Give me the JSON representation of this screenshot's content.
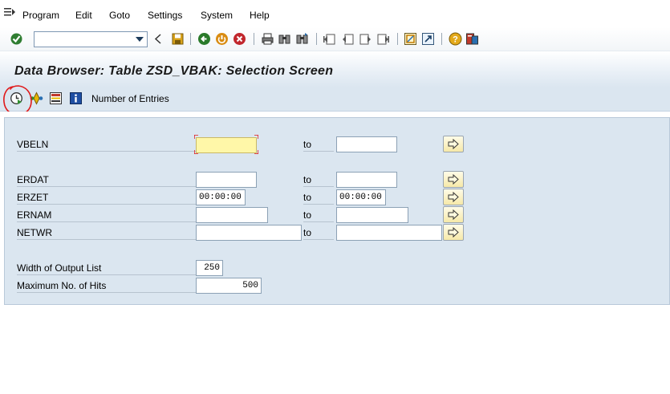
{
  "menubar": {
    "items": [
      "Program",
      "Edit",
      "Goto",
      "Settings",
      "System",
      "Help"
    ]
  },
  "toolbar": {
    "command_field_value": "",
    "icons": [
      "enter-icon",
      "back-icon",
      "exit-icon",
      "cancel-icon",
      "save-icon",
      "print-icon",
      "find-icon",
      "find-next-icon",
      "first-page-icon",
      "previous-page-icon",
      "next-page-icon",
      "last-page-icon",
      "create-session-icon",
      "shortcut-icon",
      "help-icon",
      "layout-icon"
    ]
  },
  "title": "Data Browser: Table ZSD_VBAK: Selection Screen",
  "app_toolbar": {
    "number_of_entries_label": "Number of Entries",
    "icons": [
      "execute-icon",
      "selection-options-icon",
      "field-selection-icon",
      "info-icon"
    ]
  },
  "selection": {
    "rows": [
      {
        "label": "VBELN",
        "to": "to",
        "low": "",
        "high": ""
      },
      {
        "label": "ERDAT",
        "to": "to",
        "low": "",
        "high": ""
      },
      {
        "label": "ERZET",
        "to": "to",
        "low": "00:00:00",
        "high": "00:00:00"
      },
      {
        "label": "ERNAM",
        "to": "to",
        "low": "",
        "high": ""
      },
      {
        "label": "NETWR",
        "to": "to",
        "low": "",
        "high": ""
      }
    ],
    "settings": [
      {
        "label": "Width of Output List",
        "value": "250"
      },
      {
        "label": "Maximum No. of Hits",
        "value": "500"
      }
    ]
  },
  "colors": {
    "panel_bg": "#dbe6f0",
    "focused_field_bg": "#fff7a8",
    "annotation": "#e0191a"
  }
}
